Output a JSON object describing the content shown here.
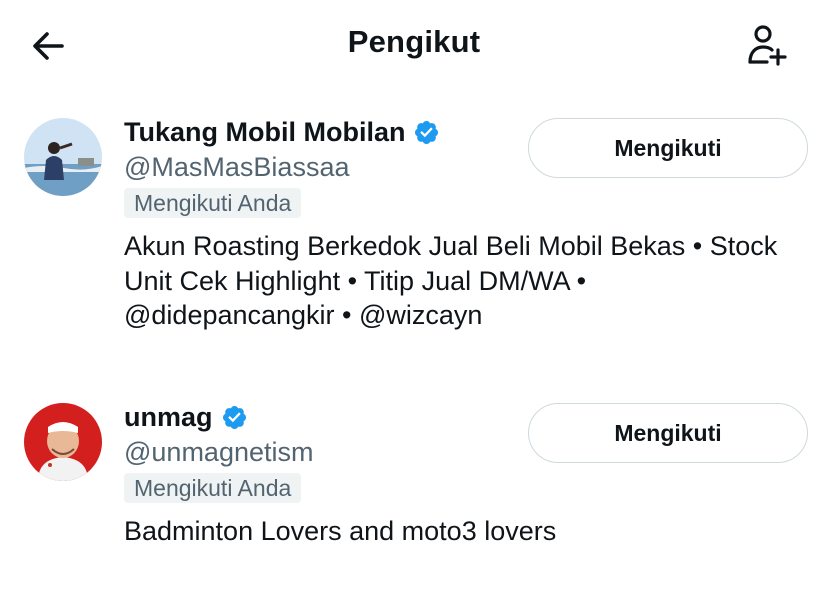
{
  "header": {
    "title": "Pengikut"
  },
  "users": [
    {
      "name": "Tukang Mobil Mobilan",
      "handle": "@MasMasBiassaa",
      "follows_you": "Mengikuti Anda",
      "bio": "Akun Roasting Berkedok Jual Beli Mobil Bekas • Stock Unit Cek Highlight • Titip Jual DM/WA • @didepancangkir • @wizcayn",
      "follow_label": "Mengikuti",
      "verified": true
    },
    {
      "name": "unmag",
      "handle": "@unmagnetism",
      "follows_you": "Mengikuti Anda",
      "bio": "Badminton Lovers and moto3 lovers",
      "follow_label": "Mengikuti",
      "verified": true
    }
  ],
  "colors": {
    "verified": "#1d9bf0",
    "secondary_text": "#536471",
    "badge_bg": "#eff3f4",
    "border": "#cfd9de"
  }
}
